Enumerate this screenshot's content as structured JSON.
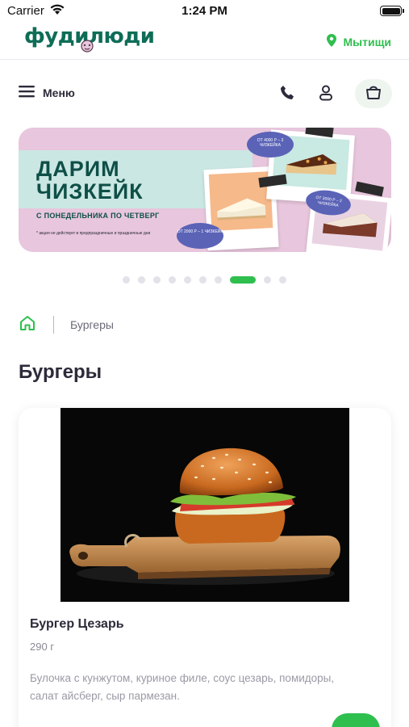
{
  "status_bar": {
    "carrier": "Carrier",
    "time": "1:24 PM"
  },
  "header": {
    "logo_text": "фудилюди",
    "city": "Мытищи"
  },
  "nav": {
    "menu_label": "Меню",
    "icons": [
      "menu-icon",
      "phone-icon",
      "user-icon",
      "cart-icon"
    ]
  },
  "banner": {
    "title_line1": "ДАРИМ",
    "title_line2": "ЧИЗКЕЙК",
    "subtitle": "С ПОНЕДЕЛЬНИКА ПО ЧЕТВЕРГ",
    "note": "* акция не действует в предпраздничные и праздничные дни",
    "tag1": "ОТ 4000 Р – 3 ЧИЗКЕЙКА",
    "tag2": "ОТ 3000 Р – 2 ЧИЗКЕЙКА",
    "tag3": "ОТ 2000 Р – 1 ЧИЗКЕЙК",
    "colors": {
      "background": "#e8c6dd",
      "mint": "#cbe7e3",
      "text": "#0e4f47",
      "tag": "#5b63b7"
    }
  },
  "carousel": {
    "total_slides": 10,
    "active_index": 7
  },
  "breadcrumb": {
    "home_icon": "home-icon",
    "current": "Бургеры"
  },
  "page": {
    "title": "Бургеры"
  },
  "product": {
    "name": "Бургер Цезарь",
    "weight": "290 г",
    "description": "Булочка с кунжутом, куриное филе, соус цезарь, помидоры, салат айсберг, сыр пармезан."
  },
  "colors": {
    "accent": "#2fbf4f",
    "brand": "#0e6d57",
    "text": "#2b2b3a",
    "muted": "#9a9aa6"
  }
}
